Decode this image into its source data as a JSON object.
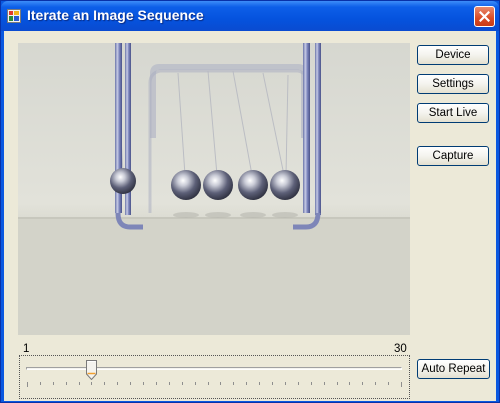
{
  "window": {
    "title": "Iterate an Image Sequence",
    "app_icon": "application-icon",
    "close_icon": "close-icon",
    "titlebar_color": "#0553de",
    "close_color": "#d94b25"
  },
  "buttons": {
    "device": "Device",
    "settings": "Settings",
    "start_live": "Start Live",
    "capture": "Capture",
    "auto_repeat": "Auto Repeat"
  },
  "slider": {
    "min_label": "1",
    "max_label": "30",
    "min": 1,
    "max": 30,
    "value": 6
  },
  "video": {
    "ball_count": 5
  }
}
